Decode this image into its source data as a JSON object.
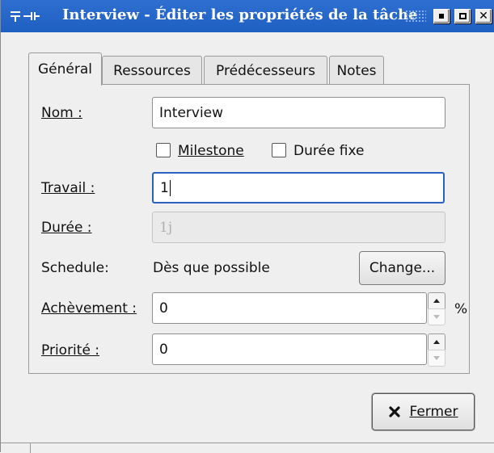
{
  "window": {
    "title": "Interview - Éditer les propriétés de la tâche",
    "menu_icon": "window-menu-icon",
    "controls": [
      "minimize-icon",
      "maximize-icon",
      "close-icon"
    ],
    "close_glyph": "✕"
  },
  "tabs": [
    {
      "label": "Général",
      "active": true
    },
    {
      "label": "Ressources",
      "active": false
    },
    {
      "label": "Prédécesseurs",
      "active": false
    },
    {
      "label": "Notes",
      "active": false
    }
  ],
  "form": {
    "name": {
      "label": "Nom :",
      "value": "Interview"
    },
    "milestone": {
      "label": "Milestone",
      "checked": false
    },
    "fixed_duration": {
      "label": "Durée fixe",
      "checked": false
    },
    "work": {
      "label": "Travail :",
      "value": "1"
    },
    "duration": {
      "label": "Durée :",
      "value": "1j"
    },
    "schedule": {
      "label": "Schedule:",
      "value": "Dès que possible",
      "change_label": "Change..."
    },
    "completion": {
      "label": "Achèvement :",
      "value": "0",
      "unit": "%"
    },
    "priority": {
      "label": "Priorité :",
      "value": "0"
    }
  },
  "footer": {
    "close_label": "Fermer",
    "close_icon": "close-x-icon"
  },
  "colors": {
    "titlebar": "#1e5fc2",
    "focus": "#2b62c0",
    "window_bg": "#efefef"
  }
}
